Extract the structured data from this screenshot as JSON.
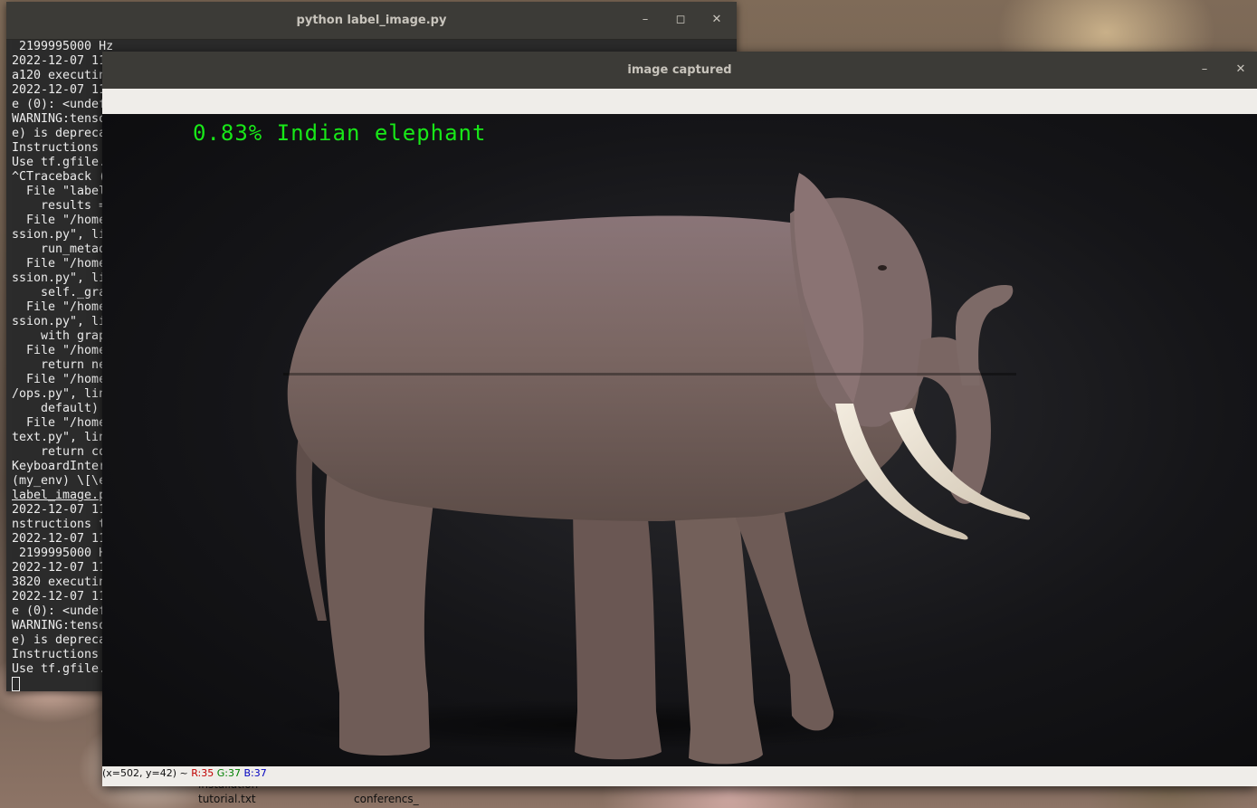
{
  "desktop": {
    "icons": [
      {
        "label": "installation"
      },
      {
        "label": "tutorial.txt"
      },
      {
        "label": "conferencs_"
      }
    ]
  },
  "terminal": {
    "title": "python label_image.py",
    "lines": [
      " 2199995000 Hz",
      "2022-12-07 11",
      "a120 executin",
      "2022-12-07 11",
      "e (0): <undef",
      "WARNING:tenso",
      "e) is depreca",
      "Instructions",
      "Use tf.gfile.",
      "^CTraceback (",
      "  File \"label",
      "    results =",
      "  File \"/home",
      "ssion.py\", li",
      "    run_metad",
      "  File \"/home",
      "ssion.py\", li",
      "    self._gra",
      "  File \"/home",
      "ssion.py\", li",
      "    with grap",
      "  File \"/home",
      "    return ne",
      "  File \"/home",
      "/ops.py\", lin",
      "    default)",
      "  File \"/home",
      "text.py\", lin",
      "    return co",
      "KeyboardInter",
      "(my_env) \\[\\e",
      "label_image.p",
      "2022-12-07 11",
      "nstructions t",
      "2022-12-07 11",
      " 2199995000 H",
      "2022-12-07 11",
      "3820 executin",
      "2022-12-07 11",
      "e (0): <undef",
      "WARNING:tenso",
      "e) is depreca",
      "Instructions",
      "Use tf.gfile."
    ]
  },
  "image_window": {
    "title": "image captured",
    "prediction": "0.83% Indian elephant",
    "status": {
      "coords": "(x=502, y=42) ~ ",
      "r": "R:35",
      "g": "G:37",
      "b": "B:37"
    }
  },
  "colors": {
    "prediction_text": "#18e818",
    "titlebar": "#3c3b37"
  },
  "icons": {
    "minimize": "minimize-icon",
    "maximize": "maximize-icon",
    "close": "close-icon"
  }
}
